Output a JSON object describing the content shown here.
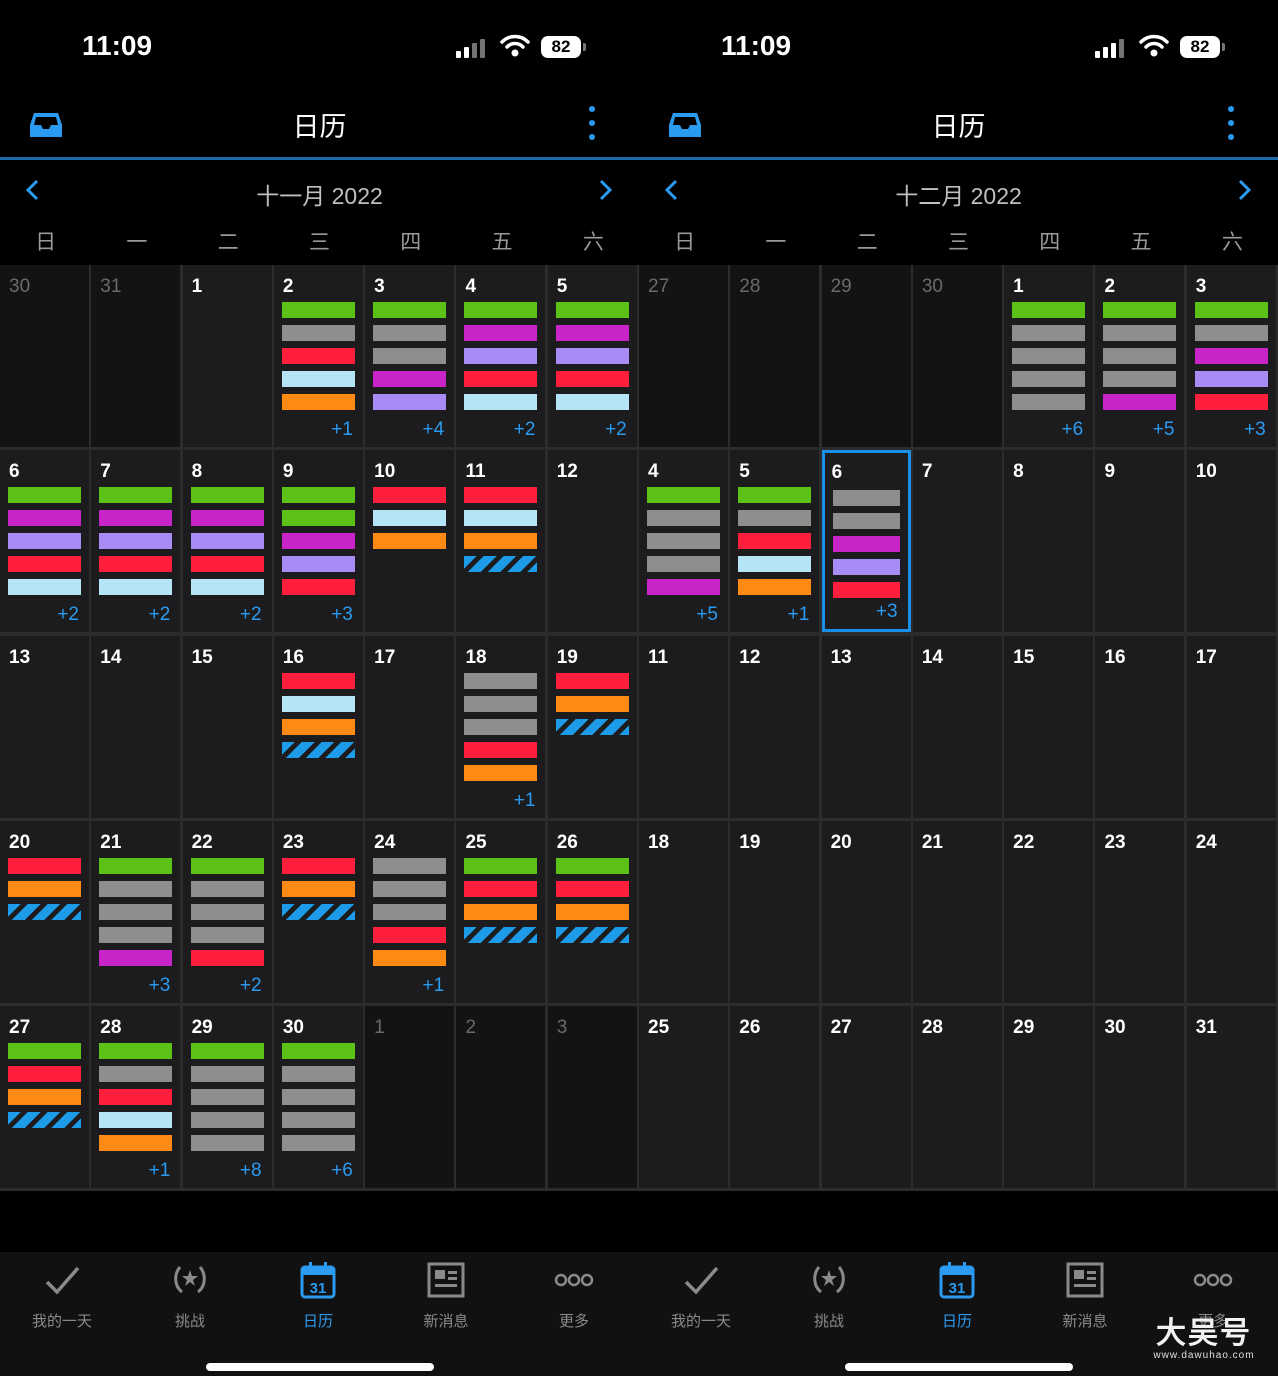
{
  "colors": {
    "green": "#5cc21a",
    "gray": "#8e8e8e",
    "red": "#ff1f3d",
    "lightblue": "#b5e3f8",
    "orange": "#ff8a14",
    "magenta": "#c824c8",
    "lavender": "#a98bf5",
    "accent": "#2a9bf0"
  },
  "screens": [
    {
      "status": {
        "time": "11:09",
        "battery": "82"
      },
      "header": {
        "title": "日历"
      },
      "month": {
        "label": "十一月 2022"
      },
      "weekdays": [
        "日",
        "一",
        "二",
        "三",
        "四",
        "五",
        "六"
      ],
      "tabs": [
        {
          "label": "我的一天",
          "icon": "check-icon"
        },
        {
          "label": "挑战",
          "icon": "laurel-icon"
        },
        {
          "label": "日历",
          "icon": "calendar-icon",
          "active": true
        },
        {
          "label": "新消息",
          "icon": "news-icon"
        },
        {
          "label": "更多",
          "icon": "more-dots-icon"
        }
      ],
      "weeks": [
        [
          {
            "day": "30",
            "other": true
          },
          {
            "day": "31",
            "other": true
          },
          {
            "day": "1"
          },
          {
            "day": "2",
            "bars": [
              "green",
              "gray",
              "red",
              "lightblue",
              "orange"
            ],
            "more": "+1"
          },
          {
            "day": "3",
            "bars": [
              "green",
              "gray",
              "gray",
              "magenta",
              "lavender"
            ],
            "more": "+4"
          },
          {
            "day": "4",
            "bars": [
              "green",
              "magenta",
              "lavender",
              "red",
              "lightblue"
            ],
            "more": "+2"
          },
          {
            "day": "5",
            "bars": [
              "green",
              "magenta",
              "lavender",
              "red",
              "lightblue"
            ],
            "more": "+2"
          }
        ],
        [
          {
            "day": "6",
            "bars": [
              "green",
              "magenta",
              "lavender",
              "red",
              "lightblue"
            ],
            "more": "+2"
          },
          {
            "day": "7",
            "bars": [
              "green",
              "magenta",
              "lavender",
              "red",
              "lightblue"
            ],
            "more": "+2"
          },
          {
            "day": "8",
            "bars": [
              "green",
              "magenta",
              "lavender",
              "red",
              "lightblue"
            ],
            "more": "+2"
          },
          {
            "day": "9",
            "bars": [
              "green",
              "green",
              "magenta",
              "lavender",
              "red"
            ],
            "more": "+3"
          },
          {
            "day": "10",
            "bars": [
              "red",
              "lightblue",
              "orange"
            ]
          },
          {
            "day": "11",
            "bars": [
              "red",
              "lightblue",
              "orange",
              "stripe"
            ]
          },
          {
            "day": "12"
          }
        ],
        [
          {
            "day": "13"
          },
          {
            "day": "14"
          },
          {
            "day": "15"
          },
          {
            "day": "16",
            "bars": [
              "red",
              "lightblue",
              "orange",
              "stripe"
            ]
          },
          {
            "day": "17"
          },
          {
            "day": "18",
            "bars": [
              "gray",
              "gray",
              "gray",
              "red",
              "orange"
            ],
            "more": "+1"
          },
          {
            "day": "19",
            "bars": [
              "red",
              "orange",
              "stripe"
            ]
          }
        ],
        [
          {
            "day": "20",
            "bars": [
              "red",
              "orange",
              "stripe"
            ]
          },
          {
            "day": "21",
            "bars": [
              "green",
              "gray",
              "gray",
              "gray",
              "magenta"
            ],
            "more": "+3"
          },
          {
            "day": "22",
            "bars": [
              "green",
              "gray",
              "gray",
              "gray",
              "red"
            ],
            "more": "+2"
          },
          {
            "day": "23",
            "bars": [
              "red",
              "orange",
              "stripe"
            ]
          },
          {
            "day": "24",
            "bars": [
              "gray",
              "gray",
              "gray",
              "red",
              "orange"
            ],
            "more": "+1"
          },
          {
            "day": "25",
            "bars": [
              "green",
              "red",
              "orange",
              "stripe"
            ]
          },
          {
            "day": "26",
            "bars": [
              "green",
              "red",
              "orange",
              "stripe"
            ]
          }
        ],
        [
          {
            "day": "27",
            "bars": [
              "green",
              "red",
              "orange",
              "stripe"
            ]
          },
          {
            "day": "28",
            "bars": [
              "green",
              "gray",
              "red",
              "lightblue",
              "orange"
            ],
            "more": "+1"
          },
          {
            "day": "29",
            "bars": [
              "green",
              "gray",
              "gray",
              "gray",
              "gray"
            ],
            "more": "+8"
          },
          {
            "day": "30",
            "bars": [
              "green",
              "gray",
              "gray",
              "gray",
              "gray"
            ],
            "more": "+6"
          },
          {
            "day": "1",
            "other": true
          },
          {
            "day": "2",
            "other": true
          },
          {
            "day": "3",
            "other": true
          }
        ]
      ]
    },
    {
      "status": {
        "time": "11:09",
        "battery": "82"
      },
      "header": {
        "title": "日历"
      },
      "month": {
        "label": "十二月 2022"
      },
      "weekdays": [
        "日",
        "一",
        "二",
        "三",
        "四",
        "五",
        "六"
      ],
      "tabs": [
        {
          "label": "我的一天",
          "icon": "check-icon"
        },
        {
          "label": "挑战",
          "icon": "laurel-icon"
        },
        {
          "label": "日历",
          "icon": "calendar-icon",
          "active": true
        },
        {
          "label": "新消息",
          "icon": "news-icon"
        },
        {
          "label": "更多",
          "icon": "more-dots-icon"
        }
      ],
      "weeks": [
        [
          {
            "day": "27",
            "other": true
          },
          {
            "day": "28",
            "other": true
          },
          {
            "day": "29",
            "other": true
          },
          {
            "day": "30",
            "other": true
          },
          {
            "day": "1",
            "bars": [
              "green",
              "gray",
              "gray",
              "gray",
              "gray"
            ],
            "more": "+6"
          },
          {
            "day": "2",
            "bars": [
              "green",
              "gray",
              "gray",
              "gray",
              "magenta"
            ],
            "more": "+5"
          },
          {
            "day": "3",
            "bars": [
              "green",
              "gray",
              "magenta",
              "lavender",
              "red"
            ],
            "more": "+3"
          }
        ],
        [
          {
            "day": "4",
            "bars": [
              "green",
              "gray",
              "gray",
              "gray",
              "magenta"
            ],
            "more": "+5"
          },
          {
            "day": "5",
            "bars": [
              "green",
              "gray",
              "red",
              "lightblue",
              "orange"
            ],
            "more": "+1"
          },
          {
            "day": "6",
            "selected": true,
            "bars": [
              "gray",
              "gray",
              "magenta",
              "lavender",
              "red"
            ],
            "more": "+3"
          },
          {
            "day": "7"
          },
          {
            "day": "8"
          },
          {
            "day": "9"
          },
          {
            "day": "10"
          }
        ],
        [
          {
            "day": "11"
          },
          {
            "day": "12"
          },
          {
            "day": "13"
          },
          {
            "day": "14"
          },
          {
            "day": "15"
          },
          {
            "day": "16"
          },
          {
            "day": "17"
          }
        ],
        [
          {
            "day": "18"
          },
          {
            "day": "19"
          },
          {
            "day": "20"
          },
          {
            "day": "21"
          },
          {
            "day": "22"
          },
          {
            "day": "23"
          },
          {
            "day": "24"
          }
        ],
        [
          {
            "day": "25"
          },
          {
            "day": "26"
          },
          {
            "day": "27"
          },
          {
            "day": "28"
          },
          {
            "day": "29"
          },
          {
            "day": "30"
          },
          {
            "day": "31"
          }
        ]
      ]
    }
  ],
  "watermark": {
    "main": "大吴号",
    "url": "www.dawuhao.com"
  }
}
